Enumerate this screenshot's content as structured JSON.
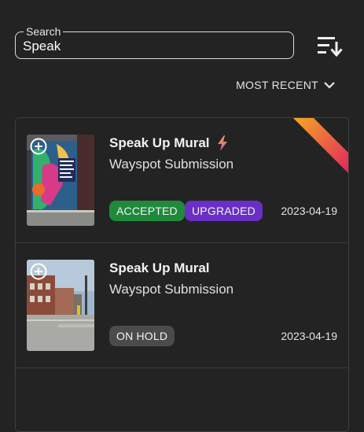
{
  "search": {
    "legend": "Search",
    "value": "Speak",
    "placeholder": ""
  },
  "sort_icon": "sort-descending-icon",
  "filter": {
    "label": "MOST RECENT",
    "icon": "chevron-down-icon"
  },
  "submissions": [
    {
      "title": "Speak Up Mural",
      "title_icon": "lightning-bolt-icon",
      "subtitle": "Wayspot Submission",
      "badges": [
        {
          "label": "ACCEPTED",
          "color": "#1f8a3c"
        },
        {
          "label": "UPGRADED",
          "color": "#6a2fc4"
        }
      ],
      "date": "2023-04-19",
      "thumb_icon": "add-circle-icon",
      "corner_ribbon_colors": [
        "#f59e21",
        "#e0265f"
      ]
    },
    {
      "title": "Speak Up Mural",
      "subtitle": "Wayspot Submission",
      "badges": [
        {
          "label": "ON HOLD",
          "color": "#4b4b4b"
        }
      ],
      "date": "2023-04-19",
      "thumb_icon": "add-circle-icon"
    }
  ]
}
